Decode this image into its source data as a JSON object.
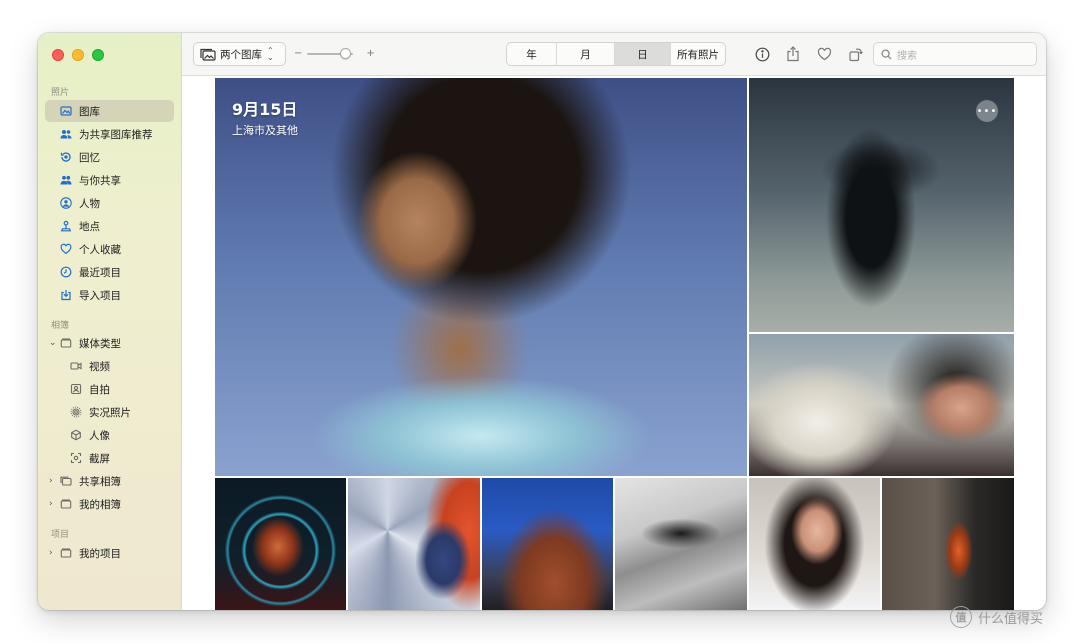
{
  "sidebar": {
    "section_photos": "照片",
    "library": "图库",
    "shared_library_suggestions": "为共享图库推荐",
    "memories": "回忆",
    "shared_with_you": "与你共享",
    "people": "人物",
    "places": "地点",
    "favorites": "个人收藏",
    "recents": "最近项目",
    "imports": "导入项目",
    "section_albums": "相簿",
    "media_types": "媒体类型",
    "videos": "视频",
    "selfies": "自拍",
    "live_photos": "实况照片",
    "portrait": "人像",
    "screenshots": "截屏",
    "shared_albums": "共享相簿",
    "my_albums": "我的相簿",
    "section_projects": "项目",
    "my_projects": "我的项目"
  },
  "toolbar": {
    "library_picker": "两个图库",
    "zoom_minus": "−",
    "zoom_plus": "+",
    "zoom_level": 0.85,
    "seg_year": "年",
    "seg_month": "月",
    "seg_day": "日",
    "seg_all": "所有照片",
    "active_segment": "日",
    "search_placeholder": "搜索"
  },
  "hero": {
    "date": "9月15日",
    "location": "上海市及其他",
    "more_label": "•••"
  },
  "watermark": {
    "logo_glyph": "值",
    "text": "什么值得买"
  },
  "colors": {
    "sidebar_accent": "#1f6fd1",
    "selected_row": "#d6d4b8",
    "traffic_red": "#fe5f57",
    "traffic_yellow": "#febc2e",
    "traffic_green": "#28c840"
  },
  "icons": {
    "library": "photo-library-icon",
    "shared_suggestions": "people-icon",
    "memories": "memories-icon",
    "shared_with_you": "shared-with-you-icon",
    "people": "person-icon",
    "places": "map-pin-icon",
    "favorites": "heart-icon",
    "recents": "clock-icon",
    "imports": "import-icon",
    "info": "info-icon",
    "share": "share-icon",
    "favorite": "heart-icon",
    "rotate": "rotate-icon",
    "search": "magnifier-icon"
  }
}
